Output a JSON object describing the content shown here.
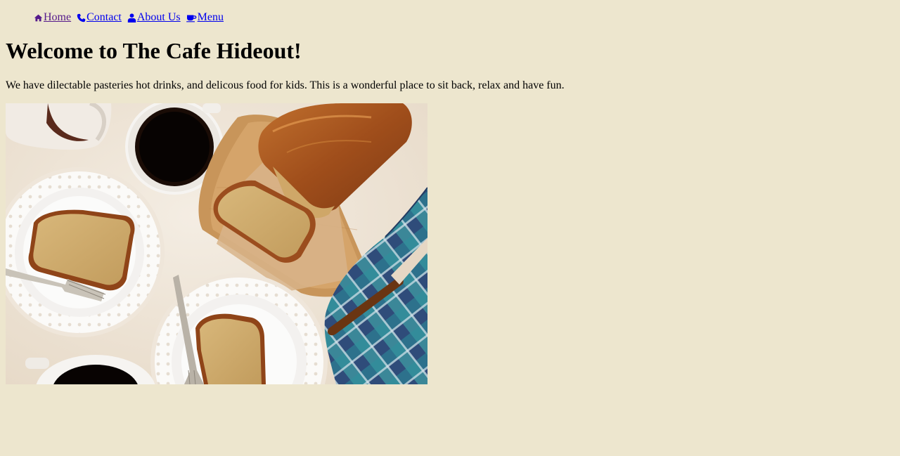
{
  "nav": {
    "items": [
      {
        "label": "Home",
        "icon": "home-icon",
        "visited": true
      },
      {
        "label": "Contact",
        "icon": "phone-icon"
      },
      {
        "label": "About Us",
        "icon": "user-icon"
      },
      {
        "label": "Menu",
        "icon": "coffee-cup-icon"
      }
    ]
  },
  "main": {
    "title": "Welcome to The Cafe Hideout!",
    "intro": "We have dilectable pasteries hot drinks, and delicous food for kids. This is a wonderful place to sit back, relax and have fun.",
    "hero_image": {
      "subject": "banana bread slices on lace doily plates with black coffee cups, a wooden board, a blue plaid napkin and a butter knife",
      "alt": ""
    }
  },
  "colors": {
    "page_background": "#ede6ce",
    "link": "#0000ee",
    "link_visited": "#551a8b"
  }
}
